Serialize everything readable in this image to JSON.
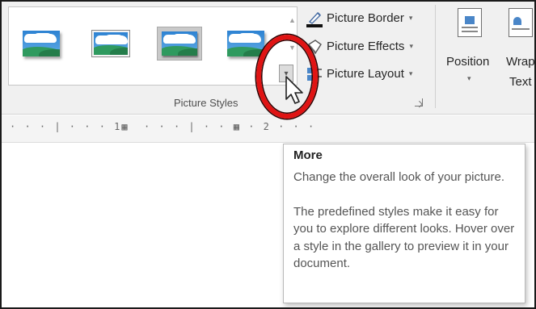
{
  "ribbon": {
    "picture_styles": {
      "group_label": "Picture Styles",
      "scroll_up_glyph": "▲",
      "more_glyph": "▾"
    },
    "commands": {
      "picture_border": "Picture Border",
      "picture_effects": "Picture Effects",
      "picture_layout": "Picture Layout",
      "caret": "▾"
    },
    "arrange": {
      "position": "Position",
      "wrap_text_line1": "Wrap",
      "wrap_text_line2": "Text",
      "caret": "▾"
    }
  },
  "ruler": {
    "marks": "· · · | · · · 1▦  · · · | · · ▦ · 2 · · ·"
  },
  "tooltip": {
    "title": "More",
    "description": "Change the overall look of your picture.",
    "detail": "The predefined styles make it easy for you to explore different looks. Hover over a style in the gallery to preview it in your document."
  },
  "colors": {
    "highlight_ring": "#e01414",
    "ribbon_bg": "#f0f0f0",
    "picture_border_bar": "#111111"
  }
}
